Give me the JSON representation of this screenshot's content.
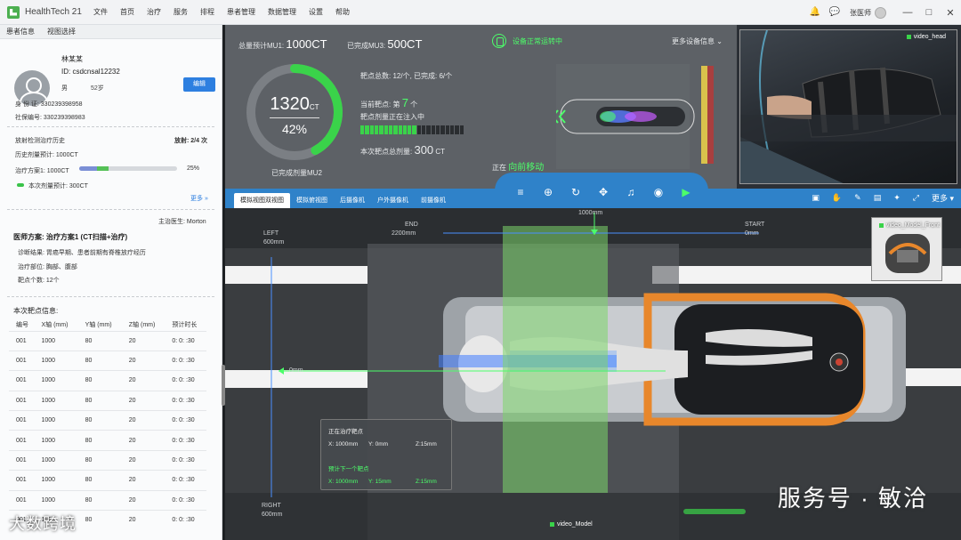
{
  "app": {
    "name": "HealthTech 21"
  },
  "menu": [
    "文件",
    "首页",
    "治疗",
    "服务",
    "排程",
    "患者管理",
    "数据管理",
    "设置",
    "帮助"
  ],
  "user": {
    "name": "张医师"
  },
  "left_tabs": [
    "患者信息",
    "视图选择"
  ],
  "patient": {
    "name": "林某某",
    "id": "ID: csdcnsal12232",
    "sex": "男",
    "age": "52岁",
    "id_card": "身 份 证: 330239398958",
    "insurance": "社保编号: 330239398983",
    "edit_label": "编辑"
  },
  "history": {
    "title": "放射检测治疗历史",
    "radiation": "放射: 2/4 次",
    "hist_dose": "历史剂量预计: 1000CT",
    "plan": "治疗方案1: 1000CT",
    "plan_pct": "25%",
    "plan_fraction_1": 0.18,
    "plan_fraction_2": 0.25,
    "this_dose": "本次剂量预计: 300CT",
    "more": "更多"
  },
  "doctor": "主治医生: Morton",
  "treatment": {
    "scheme": "医师方案: 治疗方案1 (CT扫描+治疗)",
    "diagnosis": "诊断结果: 胃癌早期、患者前期有脊椎放疗经历",
    "site": "治疗部位: 胸部、腹部",
    "targets": "靶点个数: 12个"
  },
  "targets_table": {
    "title": "本次靶点信息:",
    "headers": [
      "编号",
      "X轴 (mm)",
      "Y轴 (mm)",
      "Z轴 (mm)",
      "预计时长"
    ],
    "rows": [
      [
        "001",
        "1000",
        "80",
        "20",
        "0: 0: :30"
      ],
      [
        "001",
        "1000",
        "80",
        "20",
        "0: 0: :30"
      ],
      [
        "001",
        "1000",
        "80",
        "20",
        "0: 0: :30"
      ],
      [
        "001",
        "1000",
        "80",
        "20",
        "0: 0: :30"
      ],
      [
        "001",
        "1000",
        "80",
        "20",
        "0: 0: :30"
      ],
      [
        "001",
        "1000",
        "80",
        "20",
        "0: 0: :30"
      ],
      [
        "001",
        "1000",
        "80",
        "20",
        "0: 0: :30"
      ],
      [
        "001",
        "1000",
        "80",
        "20",
        "0: 0: :30"
      ],
      [
        "001",
        "1000",
        "80",
        "20",
        "0: 0: :30"
      ],
      [
        "001",
        "1000",
        "80",
        "20",
        "0: 0: :30"
      ]
    ]
  },
  "dash": {
    "mu1_label": "总量预计MU1:",
    "mu1_value": "1000CT",
    "mu3_label": "已完成MU3:",
    "mu3_value": "500CT",
    "ring_value": "1320",
    "ring_unit": "CT",
    "ring_pct": "42%",
    "ring_fraction": 0.42,
    "ring_caption": "已完成剂量MU2",
    "target_total": "靶点总数: 12/个, 已完成: 6/个",
    "current_label": "当前靶点: 第",
    "current_num": "7",
    "current_unit": "个",
    "injecting": "靶点剂量正在注入中",
    "progress_fraction": 0.55,
    "dose_label": "本次靶点总剂量:",
    "dose_value": "300",
    "dose_unit": "CT",
    "device_status": "设备正常运转中",
    "device_more": "更多设备信息",
    "moving_prefix": "正在",
    "moving_text": "向前移动"
  },
  "cam": {
    "label": "video_head"
  },
  "view_tabs": [
    "模拟视图双视图",
    "模拟俯视图",
    "后摄像机",
    "户外摄像机",
    "前摄像机"
  ],
  "tools": [
    "scan-icon",
    "target-icon",
    "rotate-icon",
    "move-icon",
    "mic-icon",
    "center-icon",
    "play-icon"
  ],
  "right_tools_more": "更多",
  "viewport": {
    "end_label": "END",
    "end_value": "2200mm",
    "mid_value": "1000mm",
    "start_label": "START",
    "start_value": "0mm",
    "left_label": "LEFT",
    "left_value": "600mm",
    "zero_value": "0mm",
    "right_label": "RIGHT",
    "right_value": "600mm",
    "model_label": "video_Model",
    "front_label": "video_Model_Front"
  },
  "info_panel": {
    "title": "正在治疗靶点",
    "x": "X: 1000mm",
    "y": "Y: 0mm",
    "z": "Z:15mm",
    "next_title": "预计下一个靶点",
    "nx": "X: 1000mm",
    "ny": "Y: 15mm",
    "nz": "Z:15mm"
  },
  "watermark_left": "大数跨境",
  "watermark_right": "服务号 · 敏洽",
  "colors": {
    "accent": "#2f82c9",
    "green": "#3ad34a",
    "orange": "#e8872b"
  }
}
